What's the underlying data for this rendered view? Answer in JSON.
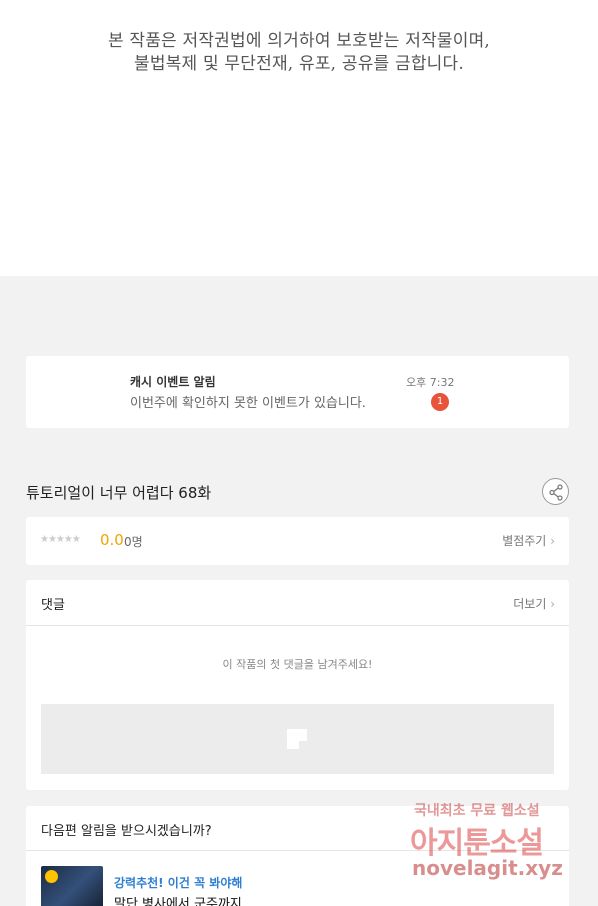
{
  "copyright": {
    "line1": "본 작품은 저작권법에 의거하여 보호받는 저작물이며,",
    "line2": "불법복제 및 무단전재, 유포, 공유를 금합니다."
  },
  "notice": {
    "title": "캐시 이벤트 알림",
    "body": "이번주에 확인하지 못한 이벤트가 있습니다.",
    "time": "오후 7:32",
    "badge": "1"
  },
  "episode": {
    "title": "튜토리얼이 너무 어렵다 68화"
  },
  "rating": {
    "stars": "★★★★★",
    "score": "0.0",
    "count": "0명",
    "rate_link": "별점주기"
  },
  "comments": {
    "title": "댓글",
    "more": "더보기",
    "empty": "이 작품의 첫 댓글을 남겨주세요!"
  },
  "next_alert": {
    "question": "다음편 알림을 받으시겠습니까?",
    "rec_label": "강력추천! 이건 꼭 봐야해",
    "rec_title": "말단 병사에서 군주까지"
  },
  "watermark": {
    "line1": "국내최초 무료 웹소설",
    "line2": "아지툰소설",
    "line3": "novelagit.xyz"
  },
  "colors": {
    "accent_score": "#f5a100",
    "badge": "#e8543a",
    "rec_label": "#2f7fd1"
  }
}
